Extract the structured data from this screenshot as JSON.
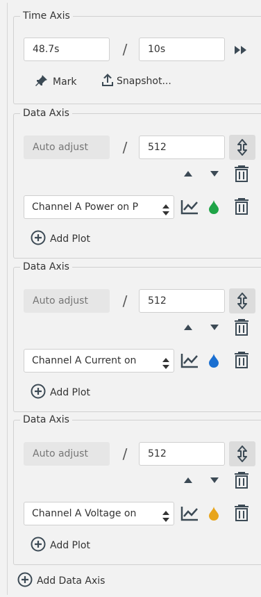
{
  "time_axis": {
    "legend": "Time Axis",
    "position_value": "48.7s",
    "separator": "/",
    "span_value": "10s",
    "mark_label": "Mark",
    "snapshot_label": "Snapshot..."
  },
  "data_axes": [
    {
      "legend": "Data Axis",
      "offset_placeholder": "Auto adjust",
      "separator": "/",
      "range_value": "512",
      "plot_channel": "Channel A Power on P",
      "plot_color": "#1fa447",
      "add_plot_label": "Add Plot"
    },
    {
      "legend": "Data Axis",
      "offset_placeholder": "Auto adjust",
      "separator": "/",
      "range_value": "512",
      "plot_channel": "Channel A Current on",
      "plot_color": "#1a6fd1",
      "add_plot_label": "Add Plot"
    },
    {
      "legend": "Data Axis",
      "offset_placeholder": "Auto adjust",
      "separator": "/",
      "range_value": "512",
      "plot_channel": "Channel A Voltage on",
      "plot_color": "#e8a51c",
      "add_plot_label": "Add Plot"
    }
  ],
  "add_data_axis_label": "Add Data Axis",
  "icon_color": "#3c4a55"
}
